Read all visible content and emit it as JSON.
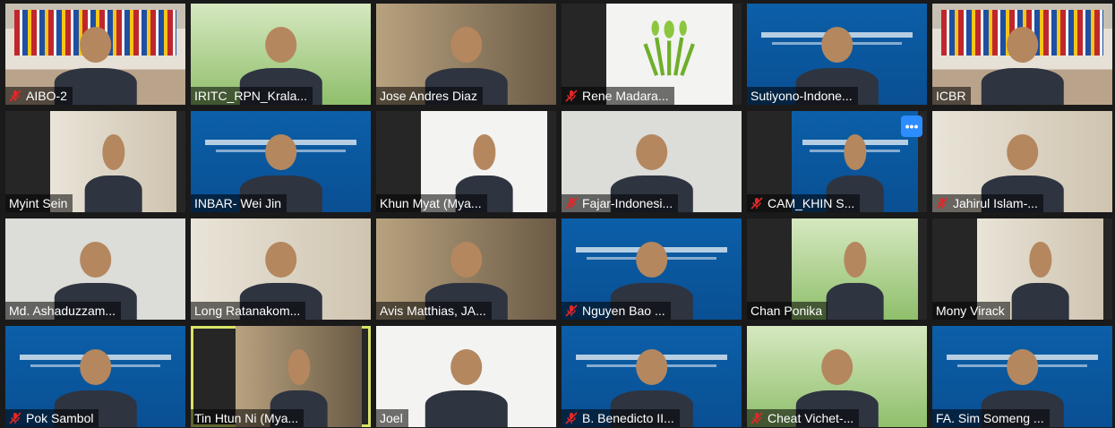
{
  "colors": {
    "active_border": "#d8e36a",
    "more_button": "#2d8cff"
  },
  "tiles": [
    {
      "name": "AIBO-2",
      "muted": true,
      "bg": "room"
    },
    {
      "name": "IRITC_RPN_Krala...",
      "muted": false,
      "bg": "green"
    },
    {
      "name": "Jose Andres Diaz",
      "muted": false,
      "bg": "shelf"
    },
    {
      "name": "Rene Madara...",
      "muted": true,
      "bg": "white"
    },
    {
      "name": "Sutiyono-Indone...",
      "muted": false,
      "bg": "blue"
    },
    {
      "name": "ICBR",
      "muted": false,
      "bg": "room"
    },
    {
      "name": "Myint Sein",
      "muted": false,
      "bg": "office"
    },
    {
      "name": "INBAR- Wei Jin",
      "muted": false,
      "bg": "blue"
    },
    {
      "name": "Khun Myat (Mya...",
      "muted": false,
      "bg": "white"
    },
    {
      "name": "Fajar-Indonesi...",
      "muted": true,
      "bg": "grey"
    },
    {
      "name": "CAM_KHIN S...",
      "muted": true,
      "bg": "blue"
    },
    {
      "name": "Jahirul Islam-...",
      "muted": true,
      "bg": "office"
    },
    {
      "name": "Md. Ashaduzzam...",
      "muted": false,
      "bg": "grey"
    },
    {
      "name": "Long Ratanakom...",
      "muted": false,
      "bg": "office"
    },
    {
      "name": "Avis Matthias, JA...",
      "muted": false,
      "bg": "shelf"
    },
    {
      "name": "Nguyen Bao ...",
      "muted": true,
      "bg": "blue"
    },
    {
      "name": "Chan Ponika",
      "muted": false,
      "bg": "green"
    },
    {
      "name": "Mony Virack",
      "muted": false,
      "bg": "office"
    },
    {
      "name": "Pok Sambol",
      "muted": true,
      "bg": "blue"
    },
    {
      "name": "Tin Htun Ni (Mya...",
      "muted": false,
      "bg": "shelf"
    },
    {
      "name": "Joel",
      "muted": false,
      "bg": "white"
    },
    {
      "name": "B. Benedicto II...",
      "muted": true,
      "bg": "blue"
    },
    {
      "name": "Cheat Vichet-...",
      "muted": true,
      "bg": "green"
    },
    {
      "name": "FA. Sim Someng ...",
      "muted": false,
      "bg": "blue"
    }
  ],
  "more_button_label": "•••",
  "more_button_tile": 10,
  "active_tile": 19,
  "icons": {
    "mute": "microphone-muted-icon",
    "more": "more-options-icon"
  }
}
